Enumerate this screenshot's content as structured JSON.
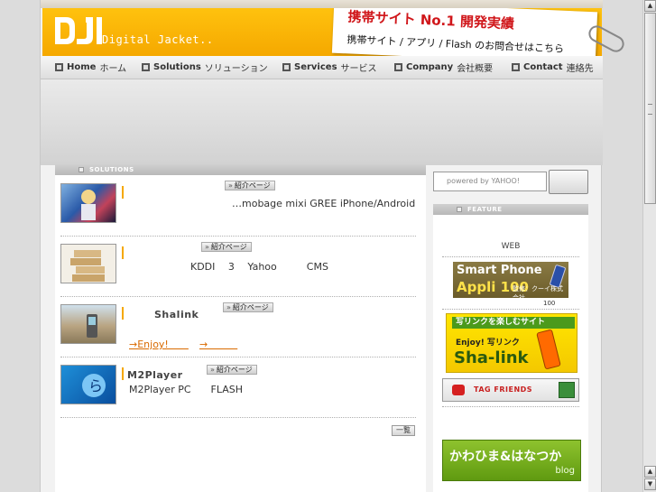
{
  "header": {
    "logo_text": "Digital Jacket..",
    "banner_line1": "携帯サイト No.1 開発実績",
    "banner_line2": "携帯サイト / アプリ / Flash のお問合せはこちら"
  },
  "nav": [
    {
      "en": "Home",
      "jp": "ホーム"
    },
    {
      "en": "Solutions",
      "jp": "ソリューション"
    },
    {
      "en": "Services",
      "jp": "サービス"
    },
    {
      "en": "Company",
      "jp": "会社概要"
    },
    {
      "en": "Contact",
      "jp": "連絡先"
    }
  ],
  "solutions": {
    "heading": "SOLUTIONS",
    "intro_label": "紹介ページ",
    "list_label": "一覧",
    "items": [
      {
        "title": "",
        "desc": "…mobage mixi GREE iPhone/Android"
      },
      {
        "title": "",
        "desc": "KDDI　 3　 Yahoo　　　CMS"
      },
      {
        "title": "Shalink",
        "link1": "→Enjoy!　　",
        "link2": "→　　　"
      },
      {
        "title": "M2Player",
        "desc": "M2Player PC　　FLASH"
      }
    ]
  },
  "sidebar": {
    "search_placeholder": "powered by YAHOO!",
    "feature_heading": "FEATURE",
    "web_label": "WEB",
    "smartphone_banner": {
      "line1": "Smart Phone",
      "line2": "Appli 100",
      "sub": "監修：クーイ株式会社",
      "caption": "100"
    },
    "shalink_banner": {
      "line1": "写リンクを楽しむサイト",
      "line2": "Enjoy! 写リンク",
      "line3": "Sha-link"
    },
    "tag_banner": {
      "label": "TAG FRIENDS"
    },
    "kawahima_banner": {
      "line1": "かわひま&はなつか",
      "line2": "blog"
    }
  },
  "colors": {
    "header_orange": "#ffc20e",
    "accent_red": "#d0161a",
    "link_orange": "#d96a00"
  }
}
